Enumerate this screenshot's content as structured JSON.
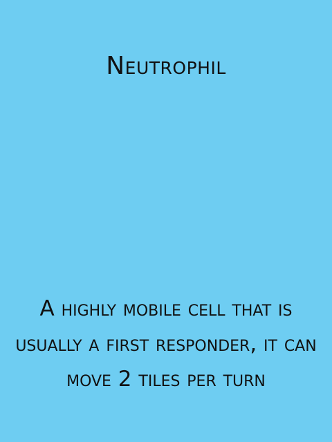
{
  "card": {
    "title": "Neutrophil",
    "description": "A highly mobile cell that is usually a first responder, it can move 2 tiles per turn",
    "background_color": "#6ecdf2",
    "text_color": "#111111"
  }
}
